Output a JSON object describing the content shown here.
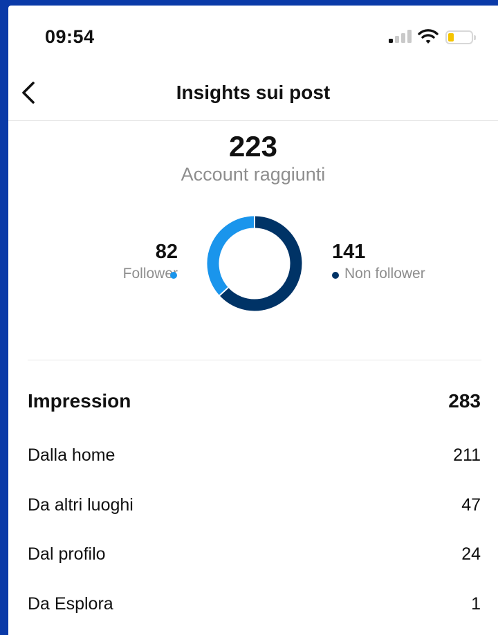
{
  "status_bar": {
    "time": "09:54",
    "signal_icon": "cellular-signal-icon",
    "wifi_icon": "wifi-icon",
    "battery_icon": "battery-low-icon",
    "battery_level": 0.25,
    "battery_color": "#f5c400"
  },
  "header": {
    "title": "Insights sui post",
    "back_icon": "chevron-left-icon"
  },
  "reach": {
    "value": "223",
    "label": "Account raggiunti",
    "followers": {
      "value": "82",
      "label": "Follower",
      "color": "#1a95ec"
    },
    "non_followers": {
      "value": "141",
      "label": "Non follower",
      "color": "#003366"
    }
  },
  "chart_data": {
    "type": "pie",
    "categories": [
      "Follower",
      "Non follower"
    ],
    "values": [
      82,
      141
    ],
    "colors": [
      "#1a95ec",
      "#003366"
    ],
    "style": "donut"
  },
  "impressions": {
    "label": "Impression",
    "value": "283",
    "rows": [
      {
        "label": "Dalla home",
        "value": "211"
      },
      {
        "label": "Da altri luoghi",
        "value": "47"
      },
      {
        "label": "Dal profilo",
        "value": "24"
      },
      {
        "label": "Da Esplora",
        "value": "1"
      }
    ]
  }
}
